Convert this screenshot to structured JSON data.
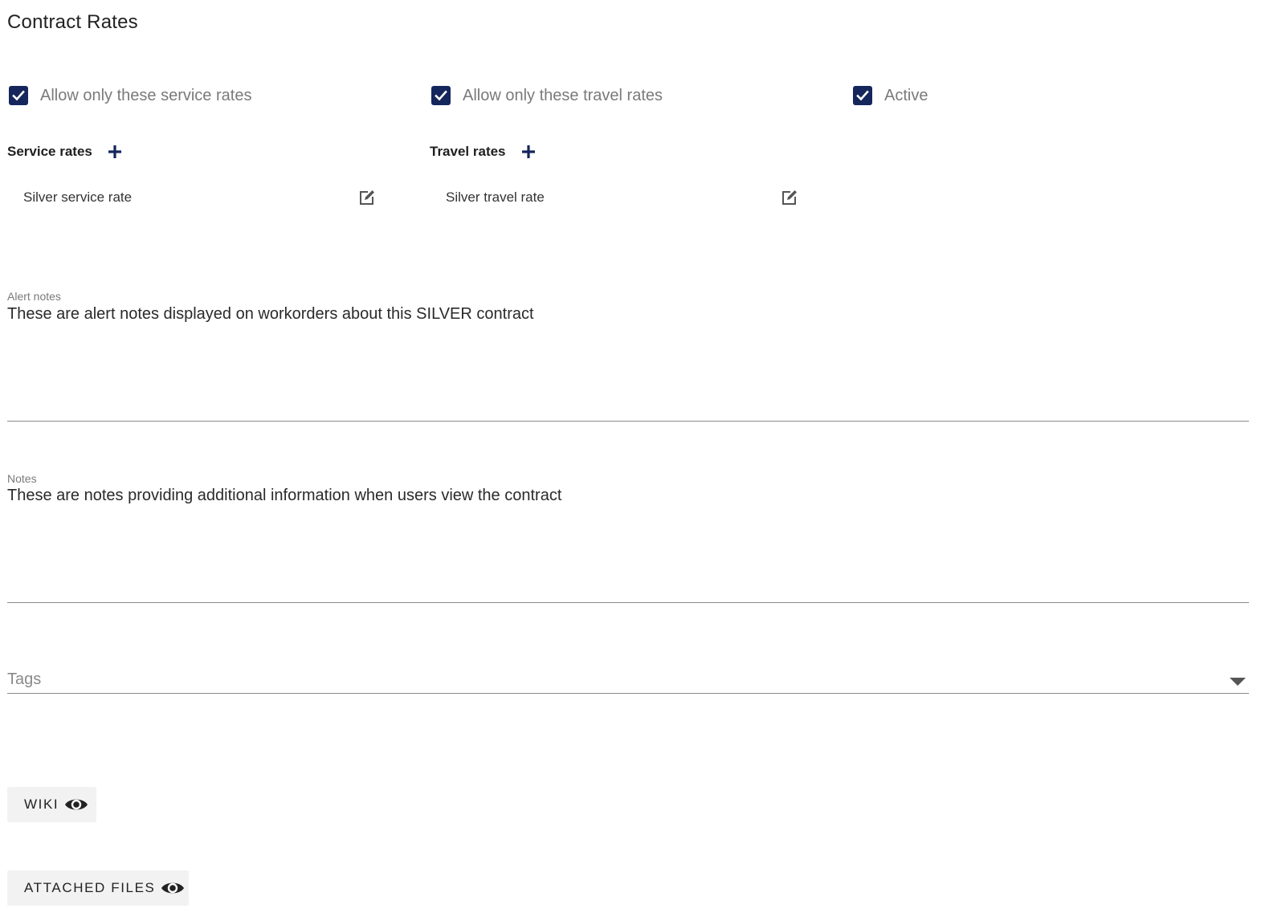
{
  "page": {
    "title": "Contract Rates"
  },
  "options": {
    "service_rates_only": {
      "label": "Allow only these service rates",
      "checked": true
    },
    "travel_rates_only": {
      "label": "Allow only these travel rates",
      "checked": true
    },
    "active": {
      "label": "Active",
      "checked": true
    }
  },
  "service_rates": {
    "header": "Service rates",
    "items": [
      {
        "label": "Silver service rate"
      }
    ]
  },
  "travel_rates": {
    "header": "Travel rates",
    "items": [
      {
        "label": "Silver travel rate"
      }
    ]
  },
  "alert_notes": {
    "label": "Alert notes",
    "value": "These are alert notes displayed on workorders about this SILVER contract"
  },
  "notes": {
    "label": "Notes",
    "value": "These are notes providing additional information when users view the contract"
  },
  "tags": {
    "placeholder": "Tags"
  },
  "buttons": {
    "wiki": "WIKI",
    "attached_files": "ATTACHED FILES"
  },
  "colors": {
    "accent": "#15265c",
    "muted_text": "#7a7a7a",
    "button_bg": "#f2f2f2"
  },
  "icons": {
    "checkbox": "check-icon",
    "add": "plus-icon",
    "edit": "edit-icon",
    "reveal": "eye-icon",
    "dropdown": "caret-down-icon"
  }
}
